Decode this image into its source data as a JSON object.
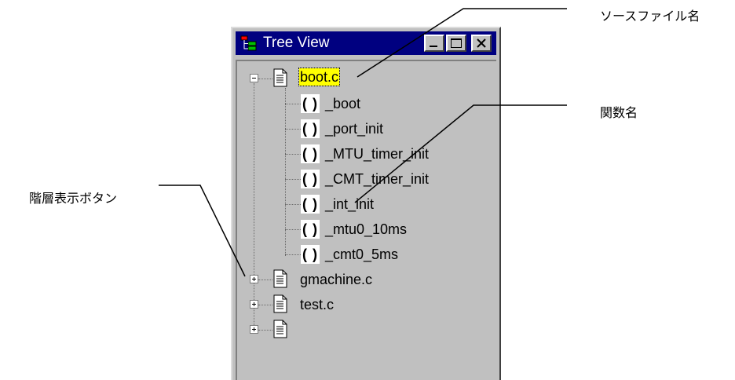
{
  "window": {
    "title": "Tree View",
    "controls": {
      "minimize": "minimize-icon",
      "maximize": "maximize-icon",
      "close": "close-icon"
    }
  },
  "tree": {
    "files": [
      {
        "name": "boot.c",
        "expanded": true,
        "selected": true,
        "functions": [
          {
            "icon_text": "( )",
            "name": "_boot"
          },
          {
            "icon_text": "( )",
            "name": "_port_init"
          },
          {
            "icon_text": "( )",
            "name": "_MTU_timer_init"
          },
          {
            "icon_text": "( )",
            "name": "_CMT_timer_init"
          },
          {
            "icon_text": "( )",
            "name": "_int_init"
          },
          {
            "icon_text": "( )",
            "name": "_mtu0_10ms"
          },
          {
            "icon_text": "( )",
            "name": "_cmt0_5ms"
          }
        ]
      },
      {
        "name": "gmachine.c",
        "expanded": false
      },
      {
        "name": "test.c",
        "expanded": false
      },
      {
        "name": "",
        "expanded": false
      }
    ]
  },
  "annotations": {
    "source_file_name": "ソースファイル名",
    "function_name": "関数名",
    "hierarchy_button": "階層表示ボタン"
  },
  "colors": {
    "title_bar": "#000080",
    "window_face": "#c0c0c0",
    "selection": "#ffff00"
  }
}
